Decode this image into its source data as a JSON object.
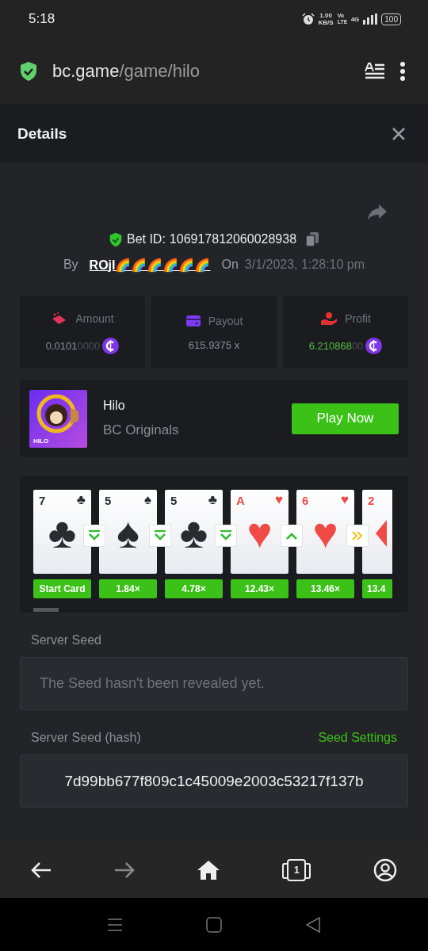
{
  "status_bar": {
    "time": "5:18",
    "speed": "1.00",
    "speed_unit": "KB/S",
    "volte": "Vo LTE",
    "network": "4G",
    "battery": "100"
  },
  "browser": {
    "domain": "bc.game",
    "path": "/game/hilo"
  },
  "details": {
    "title": "Details",
    "bet_id_label": "Bet ID:",
    "bet_id": "106917812060028938",
    "by_label": "By",
    "user": "ROjI🌈🌈🌈🌈🌈🌈",
    "on_label": "On",
    "date": "3/1/2023, 1:28:10 pm"
  },
  "stats": [
    {
      "kind": "amount",
      "label": "Amount",
      "value": "0.0101",
      "trailing_zeros": "0000",
      "coin": true,
      "positive": false
    },
    {
      "kind": "payout",
      "label": "Payout",
      "value": "615.9375 x",
      "coin": false,
      "positive": false
    },
    {
      "kind": "profit",
      "label": "Profit",
      "value": "6.210868",
      "trailing_zeros": "00",
      "coin": true,
      "positive": true
    }
  ],
  "game": {
    "thumb_label": "HILO",
    "name": "Hilo",
    "provider": "BC Originals",
    "button": "Play Now"
  },
  "cards": [
    {
      "rank": "7",
      "corner_suit": "♣",
      "center_suit": "♣",
      "red": false,
      "kind": "lower",
      "label": "Start Card"
    },
    {
      "rank": "5",
      "corner_suit": "♠",
      "center_suit": "♠",
      "red": false,
      "kind": "lower",
      "label": "1.84×"
    },
    {
      "rank": "5",
      "corner_suit": "♣",
      "center_suit": "♣",
      "red": false,
      "kind": "lower",
      "label": "4.78×"
    },
    {
      "rank": "A",
      "corner_suit": "♥",
      "center_suit": "♥",
      "red": true,
      "kind": "higher",
      "label": "12.43×"
    },
    {
      "rank": "6",
      "corner_suit": "♥",
      "center_suit": "♥",
      "red": true,
      "kind": "skip",
      "label": "13.46×"
    },
    {
      "rank": "2",
      "red": true,
      "label": "13.4"
    }
  ],
  "server_seed": {
    "label": "Server Seed",
    "placeholder": "The Seed hasn't been revealed yet."
  },
  "server_seed_hash": {
    "label": "Server Seed (hash)",
    "link": "Seed Settings",
    "value": "7d99bb677f809c1c45009e2003c53217f137b"
  },
  "nav": {
    "tabs_count": "1"
  }
}
